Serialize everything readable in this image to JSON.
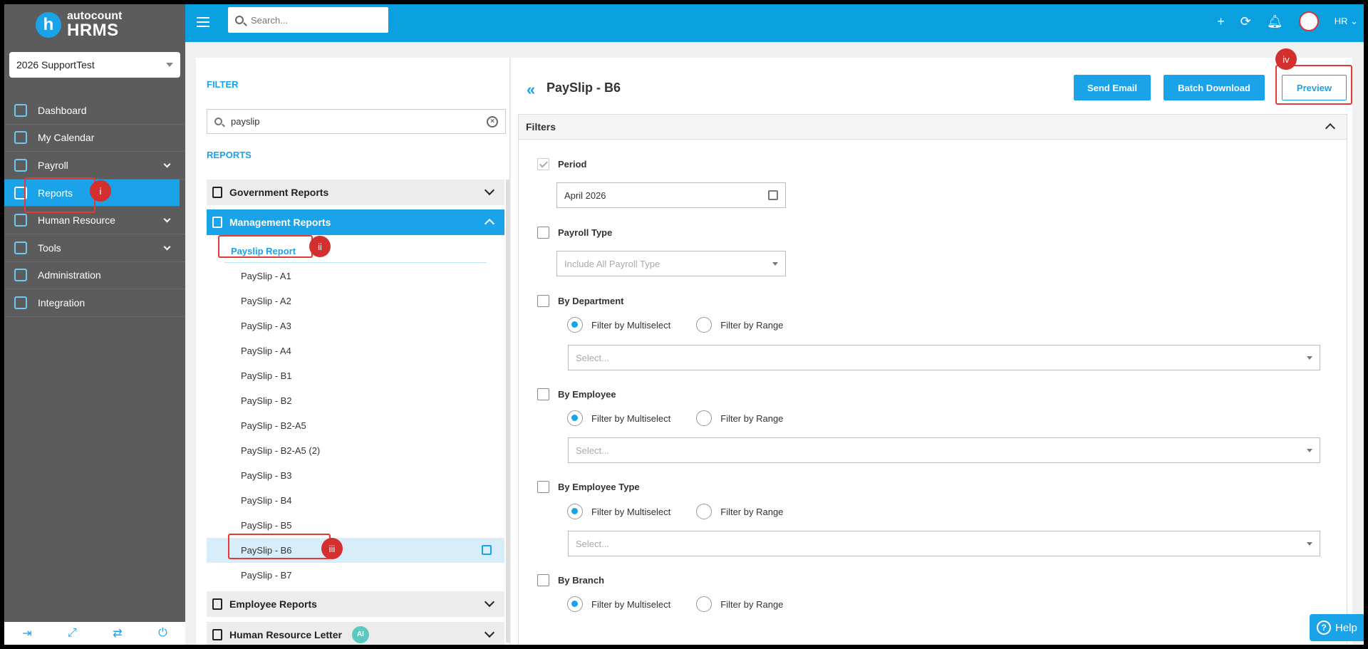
{
  "brand": {
    "line1": "autocount",
    "line2": "HRMS",
    "mark": "h"
  },
  "company": {
    "selected": "2026 SupportTest"
  },
  "sidebar": {
    "items": [
      {
        "label": "Dashboard",
        "icon": "dashboard-icon",
        "expandable": false
      },
      {
        "label": "My Calendar",
        "icon": "calendar-icon",
        "expandable": false
      },
      {
        "label": "Payroll",
        "icon": "payroll-icon",
        "expandable": true
      },
      {
        "label": "Reports",
        "icon": "reports-icon",
        "expandable": false,
        "active": true
      },
      {
        "label": "Human Resource",
        "icon": "people-icon",
        "expandable": true
      },
      {
        "label": "Tools",
        "icon": "tools-icon",
        "expandable": true
      },
      {
        "label": "Administration",
        "icon": "admin-icon",
        "expandable": false
      },
      {
        "label": "Integration",
        "icon": "integration-icon",
        "expandable": false
      }
    ],
    "bottom_icons": [
      "logout-icon",
      "fullscreen-icon",
      "language-icon",
      "power-icon"
    ]
  },
  "topbar": {
    "search_placeholder": "Search...",
    "user_label": "HR"
  },
  "filter_panel": {
    "filter_heading": "FILTER",
    "search_value": "payslip",
    "reports_heading": "REPORTS",
    "categories": {
      "government": "Government Reports",
      "management": "Management Reports",
      "employee": "Employee Reports",
      "hr_letter": "Human Resource Letter",
      "ai_badge": "AI"
    },
    "subcategory": "Payslip Report",
    "reports": [
      "PaySlip - A1",
      "PaySlip - A2",
      "PaySlip - A3",
      "PaySlip - A4",
      "PaySlip - B1",
      "PaySlip - B2",
      "PaySlip - B2-A5",
      "PaySlip - B2-A5 (2)",
      "PaySlip - B3",
      "PaySlip - B4",
      "PaySlip - B5",
      "PaySlip - B6",
      "PaySlip - B7"
    ],
    "selected_report": "PaySlip - B6"
  },
  "main": {
    "title": "PaySlip - B6",
    "buttons": {
      "send_email": "Send Email",
      "batch_download": "Batch Download",
      "preview": "Preview"
    },
    "filters_title": "Filters",
    "period": {
      "label": "Period",
      "checked": true,
      "value": "April 2026"
    },
    "payroll_type": {
      "label": "Payroll Type",
      "placeholder": "Include All Payroll Type"
    },
    "by_department": {
      "label": "By Department",
      "placeholder": "Select..."
    },
    "by_employee": {
      "label": "By Employee",
      "placeholder": "Select..."
    },
    "by_employee_type": {
      "label": "By Employee Type",
      "placeholder": "Select..."
    },
    "by_branch": {
      "label": "By Branch"
    },
    "radio_multiselect": "Filter by Multiselect",
    "radio_range": "Filter by Range"
  },
  "markers": {
    "m1": "i",
    "m2": "ii",
    "m3": "iii",
    "m4": "iv"
  },
  "help": {
    "label": "Help"
  },
  "colors": {
    "accent": "#1aa3e8",
    "sidebar": "#5c5c5c",
    "marker": "#d32f2f"
  }
}
